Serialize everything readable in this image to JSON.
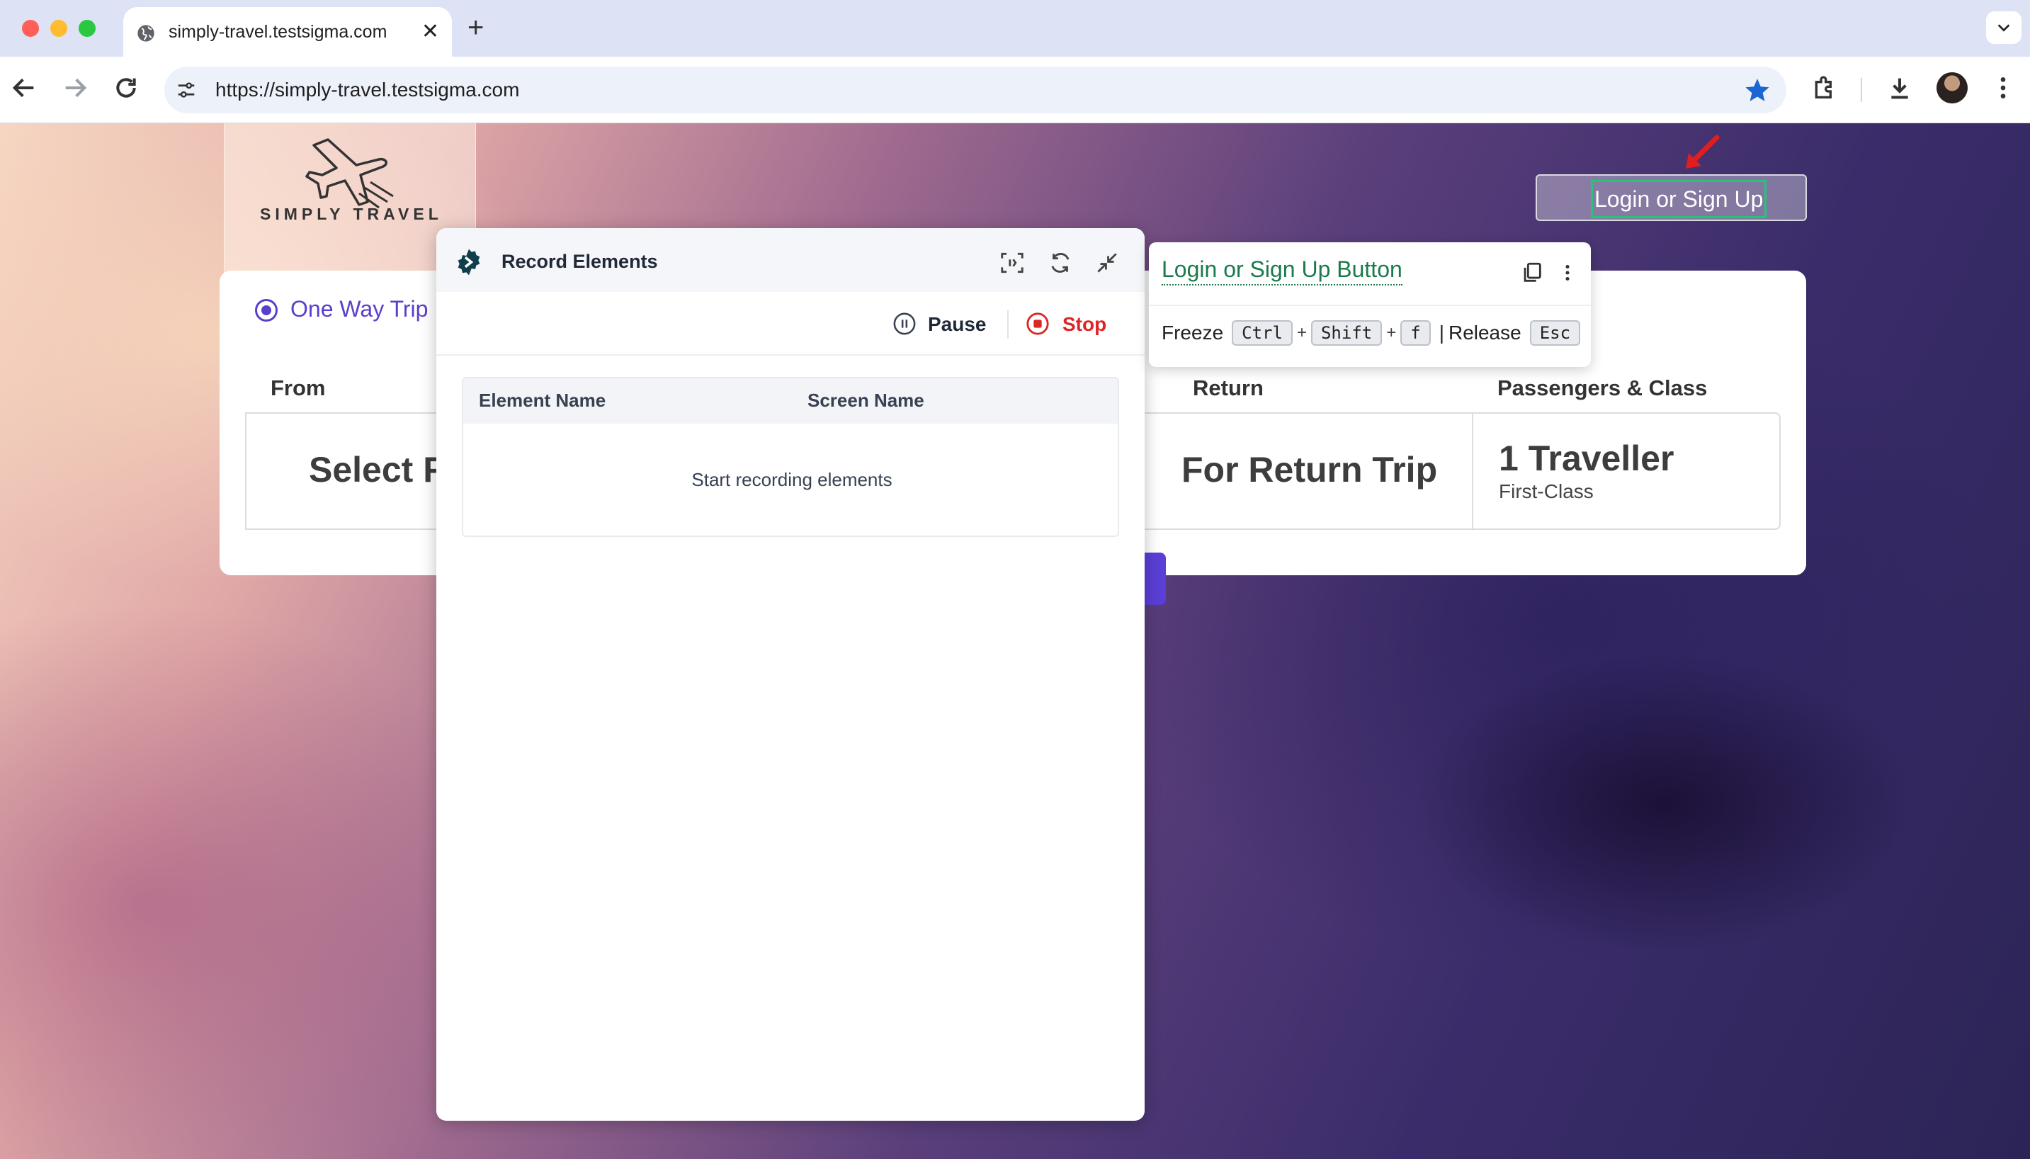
{
  "browser": {
    "tab_title": "simply-travel.testsigma.com",
    "tab_close": "✕",
    "new_tab": "+",
    "url": "https://simply-travel.testsigma.com"
  },
  "site": {
    "logo_text": "SIMPLY TRAVEL",
    "login_button": "Login or Sign Up",
    "trip_type": "One Way Trip",
    "fields": {
      "from_label": "From",
      "from_value": "Select Fr",
      "return_label": "Return",
      "return_value": "For Return Trip",
      "passengers_label": "Passengers & Class",
      "passengers_value": "1 Traveller",
      "class_value": "First-Class"
    }
  },
  "recorder": {
    "title": "Record Elements",
    "pause": "Pause",
    "stop": "Stop",
    "columns": [
      "Element Name",
      "Screen Name"
    ],
    "empty_message": "Start recording elements"
  },
  "element_tooltip": {
    "name": "Login or Sign Up Button",
    "freeze_label": "Freeze",
    "freeze_keys": [
      "Ctrl",
      "Shift",
      "f"
    ],
    "separator": "|",
    "release_label": "Release",
    "release_key": "Esc"
  },
  "colors": {
    "accent_purple": "#5a3fcb",
    "stop_red": "#dc2626",
    "highlight_green": "#28c27a",
    "element_name_green": "#1c7a4c"
  }
}
